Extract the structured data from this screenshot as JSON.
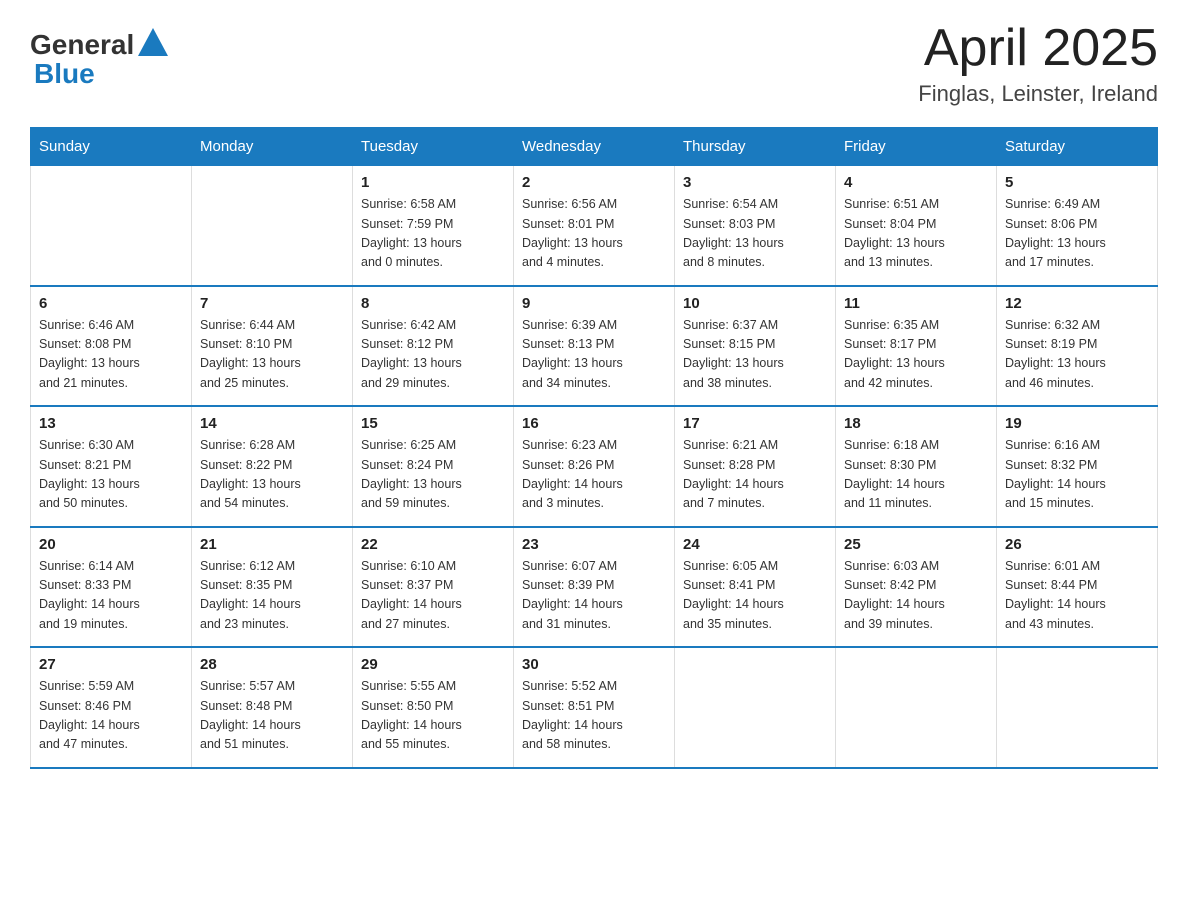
{
  "header": {
    "logo_general": "General",
    "logo_blue": "Blue",
    "month_title": "April 2025",
    "location": "Finglas, Leinster, Ireland"
  },
  "weekdays": [
    "Sunday",
    "Monday",
    "Tuesday",
    "Wednesday",
    "Thursday",
    "Friday",
    "Saturday"
  ],
  "weeks": [
    [
      {
        "day": "",
        "info": ""
      },
      {
        "day": "",
        "info": ""
      },
      {
        "day": "1",
        "info": "Sunrise: 6:58 AM\nSunset: 7:59 PM\nDaylight: 13 hours\nand 0 minutes."
      },
      {
        "day": "2",
        "info": "Sunrise: 6:56 AM\nSunset: 8:01 PM\nDaylight: 13 hours\nand 4 minutes."
      },
      {
        "day": "3",
        "info": "Sunrise: 6:54 AM\nSunset: 8:03 PM\nDaylight: 13 hours\nand 8 minutes."
      },
      {
        "day": "4",
        "info": "Sunrise: 6:51 AM\nSunset: 8:04 PM\nDaylight: 13 hours\nand 13 minutes."
      },
      {
        "day": "5",
        "info": "Sunrise: 6:49 AM\nSunset: 8:06 PM\nDaylight: 13 hours\nand 17 minutes."
      }
    ],
    [
      {
        "day": "6",
        "info": "Sunrise: 6:46 AM\nSunset: 8:08 PM\nDaylight: 13 hours\nand 21 minutes."
      },
      {
        "day": "7",
        "info": "Sunrise: 6:44 AM\nSunset: 8:10 PM\nDaylight: 13 hours\nand 25 minutes."
      },
      {
        "day": "8",
        "info": "Sunrise: 6:42 AM\nSunset: 8:12 PM\nDaylight: 13 hours\nand 29 minutes."
      },
      {
        "day": "9",
        "info": "Sunrise: 6:39 AM\nSunset: 8:13 PM\nDaylight: 13 hours\nand 34 minutes."
      },
      {
        "day": "10",
        "info": "Sunrise: 6:37 AM\nSunset: 8:15 PM\nDaylight: 13 hours\nand 38 minutes."
      },
      {
        "day": "11",
        "info": "Sunrise: 6:35 AM\nSunset: 8:17 PM\nDaylight: 13 hours\nand 42 minutes."
      },
      {
        "day": "12",
        "info": "Sunrise: 6:32 AM\nSunset: 8:19 PM\nDaylight: 13 hours\nand 46 minutes."
      }
    ],
    [
      {
        "day": "13",
        "info": "Sunrise: 6:30 AM\nSunset: 8:21 PM\nDaylight: 13 hours\nand 50 minutes."
      },
      {
        "day": "14",
        "info": "Sunrise: 6:28 AM\nSunset: 8:22 PM\nDaylight: 13 hours\nand 54 minutes."
      },
      {
        "day": "15",
        "info": "Sunrise: 6:25 AM\nSunset: 8:24 PM\nDaylight: 13 hours\nand 59 minutes."
      },
      {
        "day": "16",
        "info": "Sunrise: 6:23 AM\nSunset: 8:26 PM\nDaylight: 14 hours\nand 3 minutes."
      },
      {
        "day": "17",
        "info": "Sunrise: 6:21 AM\nSunset: 8:28 PM\nDaylight: 14 hours\nand 7 minutes."
      },
      {
        "day": "18",
        "info": "Sunrise: 6:18 AM\nSunset: 8:30 PM\nDaylight: 14 hours\nand 11 minutes."
      },
      {
        "day": "19",
        "info": "Sunrise: 6:16 AM\nSunset: 8:32 PM\nDaylight: 14 hours\nand 15 minutes."
      }
    ],
    [
      {
        "day": "20",
        "info": "Sunrise: 6:14 AM\nSunset: 8:33 PM\nDaylight: 14 hours\nand 19 minutes."
      },
      {
        "day": "21",
        "info": "Sunrise: 6:12 AM\nSunset: 8:35 PM\nDaylight: 14 hours\nand 23 minutes."
      },
      {
        "day": "22",
        "info": "Sunrise: 6:10 AM\nSunset: 8:37 PM\nDaylight: 14 hours\nand 27 minutes."
      },
      {
        "day": "23",
        "info": "Sunrise: 6:07 AM\nSunset: 8:39 PM\nDaylight: 14 hours\nand 31 minutes."
      },
      {
        "day": "24",
        "info": "Sunrise: 6:05 AM\nSunset: 8:41 PM\nDaylight: 14 hours\nand 35 minutes."
      },
      {
        "day": "25",
        "info": "Sunrise: 6:03 AM\nSunset: 8:42 PM\nDaylight: 14 hours\nand 39 minutes."
      },
      {
        "day": "26",
        "info": "Sunrise: 6:01 AM\nSunset: 8:44 PM\nDaylight: 14 hours\nand 43 minutes."
      }
    ],
    [
      {
        "day": "27",
        "info": "Sunrise: 5:59 AM\nSunset: 8:46 PM\nDaylight: 14 hours\nand 47 minutes."
      },
      {
        "day": "28",
        "info": "Sunrise: 5:57 AM\nSunset: 8:48 PM\nDaylight: 14 hours\nand 51 minutes."
      },
      {
        "day": "29",
        "info": "Sunrise: 5:55 AM\nSunset: 8:50 PM\nDaylight: 14 hours\nand 55 minutes."
      },
      {
        "day": "30",
        "info": "Sunrise: 5:52 AM\nSunset: 8:51 PM\nDaylight: 14 hours\nand 58 minutes."
      },
      {
        "day": "",
        "info": ""
      },
      {
        "day": "",
        "info": ""
      },
      {
        "day": "",
        "info": ""
      }
    ]
  ]
}
